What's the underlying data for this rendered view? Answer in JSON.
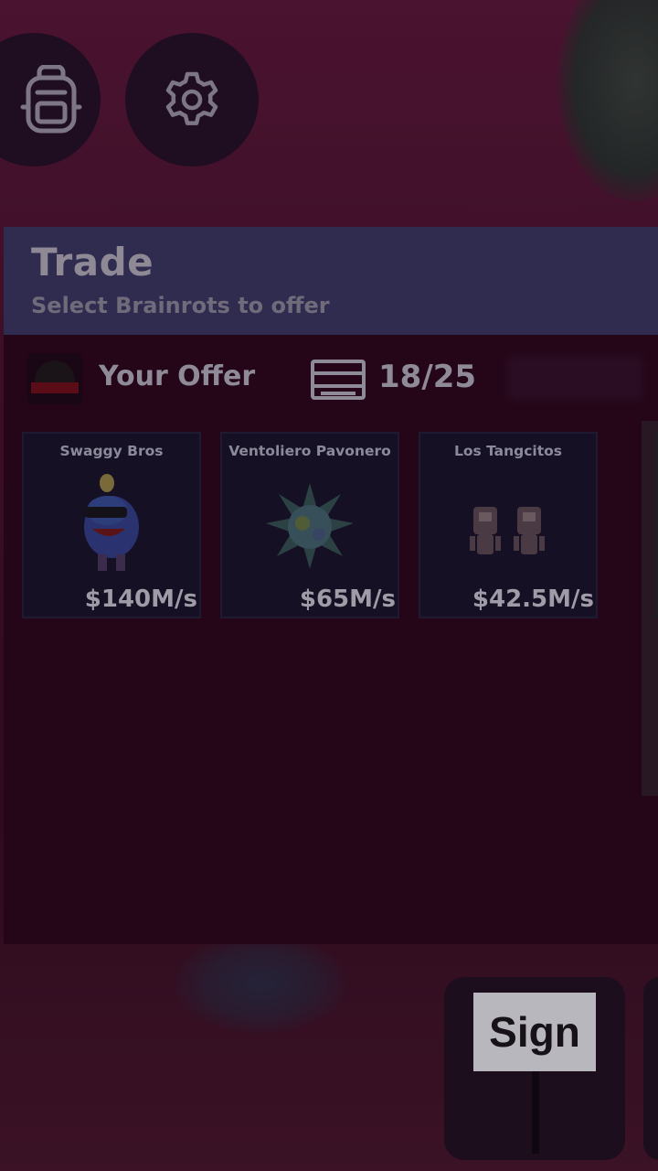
{
  "hud": {
    "backpack_icon": "backpack-icon",
    "settings_icon": "gear-icon"
  },
  "trade": {
    "title": "Trade",
    "subtitle": "Select Brainrots to offer",
    "offer_label": "Your Offer",
    "slots_used": "18/25"
  },
  "items": [
    {
      "name": "Swaggy Bros",
      "rate": "$140M/s"
    },
    {
      "name": "Ventoliero Pavonero",
      "rate": "$65M/s"
    },
    {
      "name": "Los Tangcitos",
      "rate": "$42.5M/s"
    }
  ],
  "sign": {
    "label": "Sign"
  },
  "colors": {
    "header": "#2f2c4f",
    "panel": "#250619",
    "card": "#151024",
    "text": "#8f8a97"
  }
}
